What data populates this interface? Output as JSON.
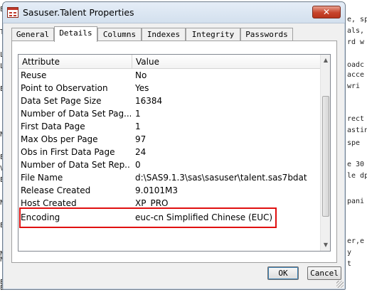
{
  "background_left": [
    "E",
    "T",
    "",
    "L",
    "L",
    "",
    "E",
    "",
    "",
    "N",
    "",
    "E",
    "V",
    "E",
    "",
    "N",
    "",
    "E",
    "",
    "",
    "N",
    "N",
    "",
    "E",
    "E",
    ""
  ],
  "background_right": [
    {
      "text": "e, sp"
    },
    {
      "text": "als,"
    },
    {
      "text": "rd w"
    },
    {
      "text": "oadc"
    },
    {
      "text": "acce"
    },
    {
      "text": " wri"
    },
    {
      "text": "rect"
    },
    {
      "text": "astin"
    },
    {
      "text": " spe"
    },
    {
      "text": "e 30"
    },
    {
      "text": "le dp"
    },
    {
      "text": "pani"
    },
    {
      "text": "er,e"
    },
    {
      "text": "y"
    },
    {
      "text": "t"
    }
  ],
  "window": {
    "title": "Sasuser.Talent Properties",
    "close_label": "✕"
  },
  "tabs": [
    {
      "label": "General",
      "active": false
    },
    {
      "label": "Details",
      "active": true
    },
    {
      "label": "Columns",
      "active": false
    },
    {
      "label": "Indexes",
      "active": false
    },
    {
      "label": "Integrity",
      "active": false
    },
    {
      "label": "Passwords",
      "active": false
    }
  ],
  "table": {
    "columns": [
      "Attribute",
      "Value"
    ],
    "rows": [
      {
        "attribute": "Reuse",
        "value": "No"
      },
      {
        "attribute": "Point to Observation",
        "value": "Yes"
      },
      {
        "attribute": "Data Set Page Size",
        "value": "16384"
      },
      {
        "attribute": "Number of Data Set Pag...",
        "value": "1"
      },
      {
        "attribute": "First Data Page",
        "value": "1"
      },
      {
        "attribute": "Max Obs per Page",
        "value": "97"
      },
      {
        "attribute": "Obs in First Data Page",
        "value": "24"
      },
      {
        "attribute": "Number of Data Set Rep...",
        "value": "0"
      },
      {
        "attribute": "File Name",
        "value": "d:\\SAS9.1.3\\sas\\sasuser\\talent.sas7bdat"
      },
      {
        "attribute": "Release Created",
        "value": "9.0101M3"
      },
      {
        "attribute": "Host Created",
        "value": "XP_PRO"
      },
      {
        "attribute": "Encoding",
        "value": "euc-cn  Simplified Chinese (EUC)"
      }
    ],
    "highlighted_row": "Encoding",
    "highlight_color": "#e01010"
  },
  "buttons": {
    "ok": "OK",
    "cancel": "Cancel"
  },
  "colors": {
    "close_button": "#c7442c",
    "title_gradient_top": "#e5edf7"
  }
}
